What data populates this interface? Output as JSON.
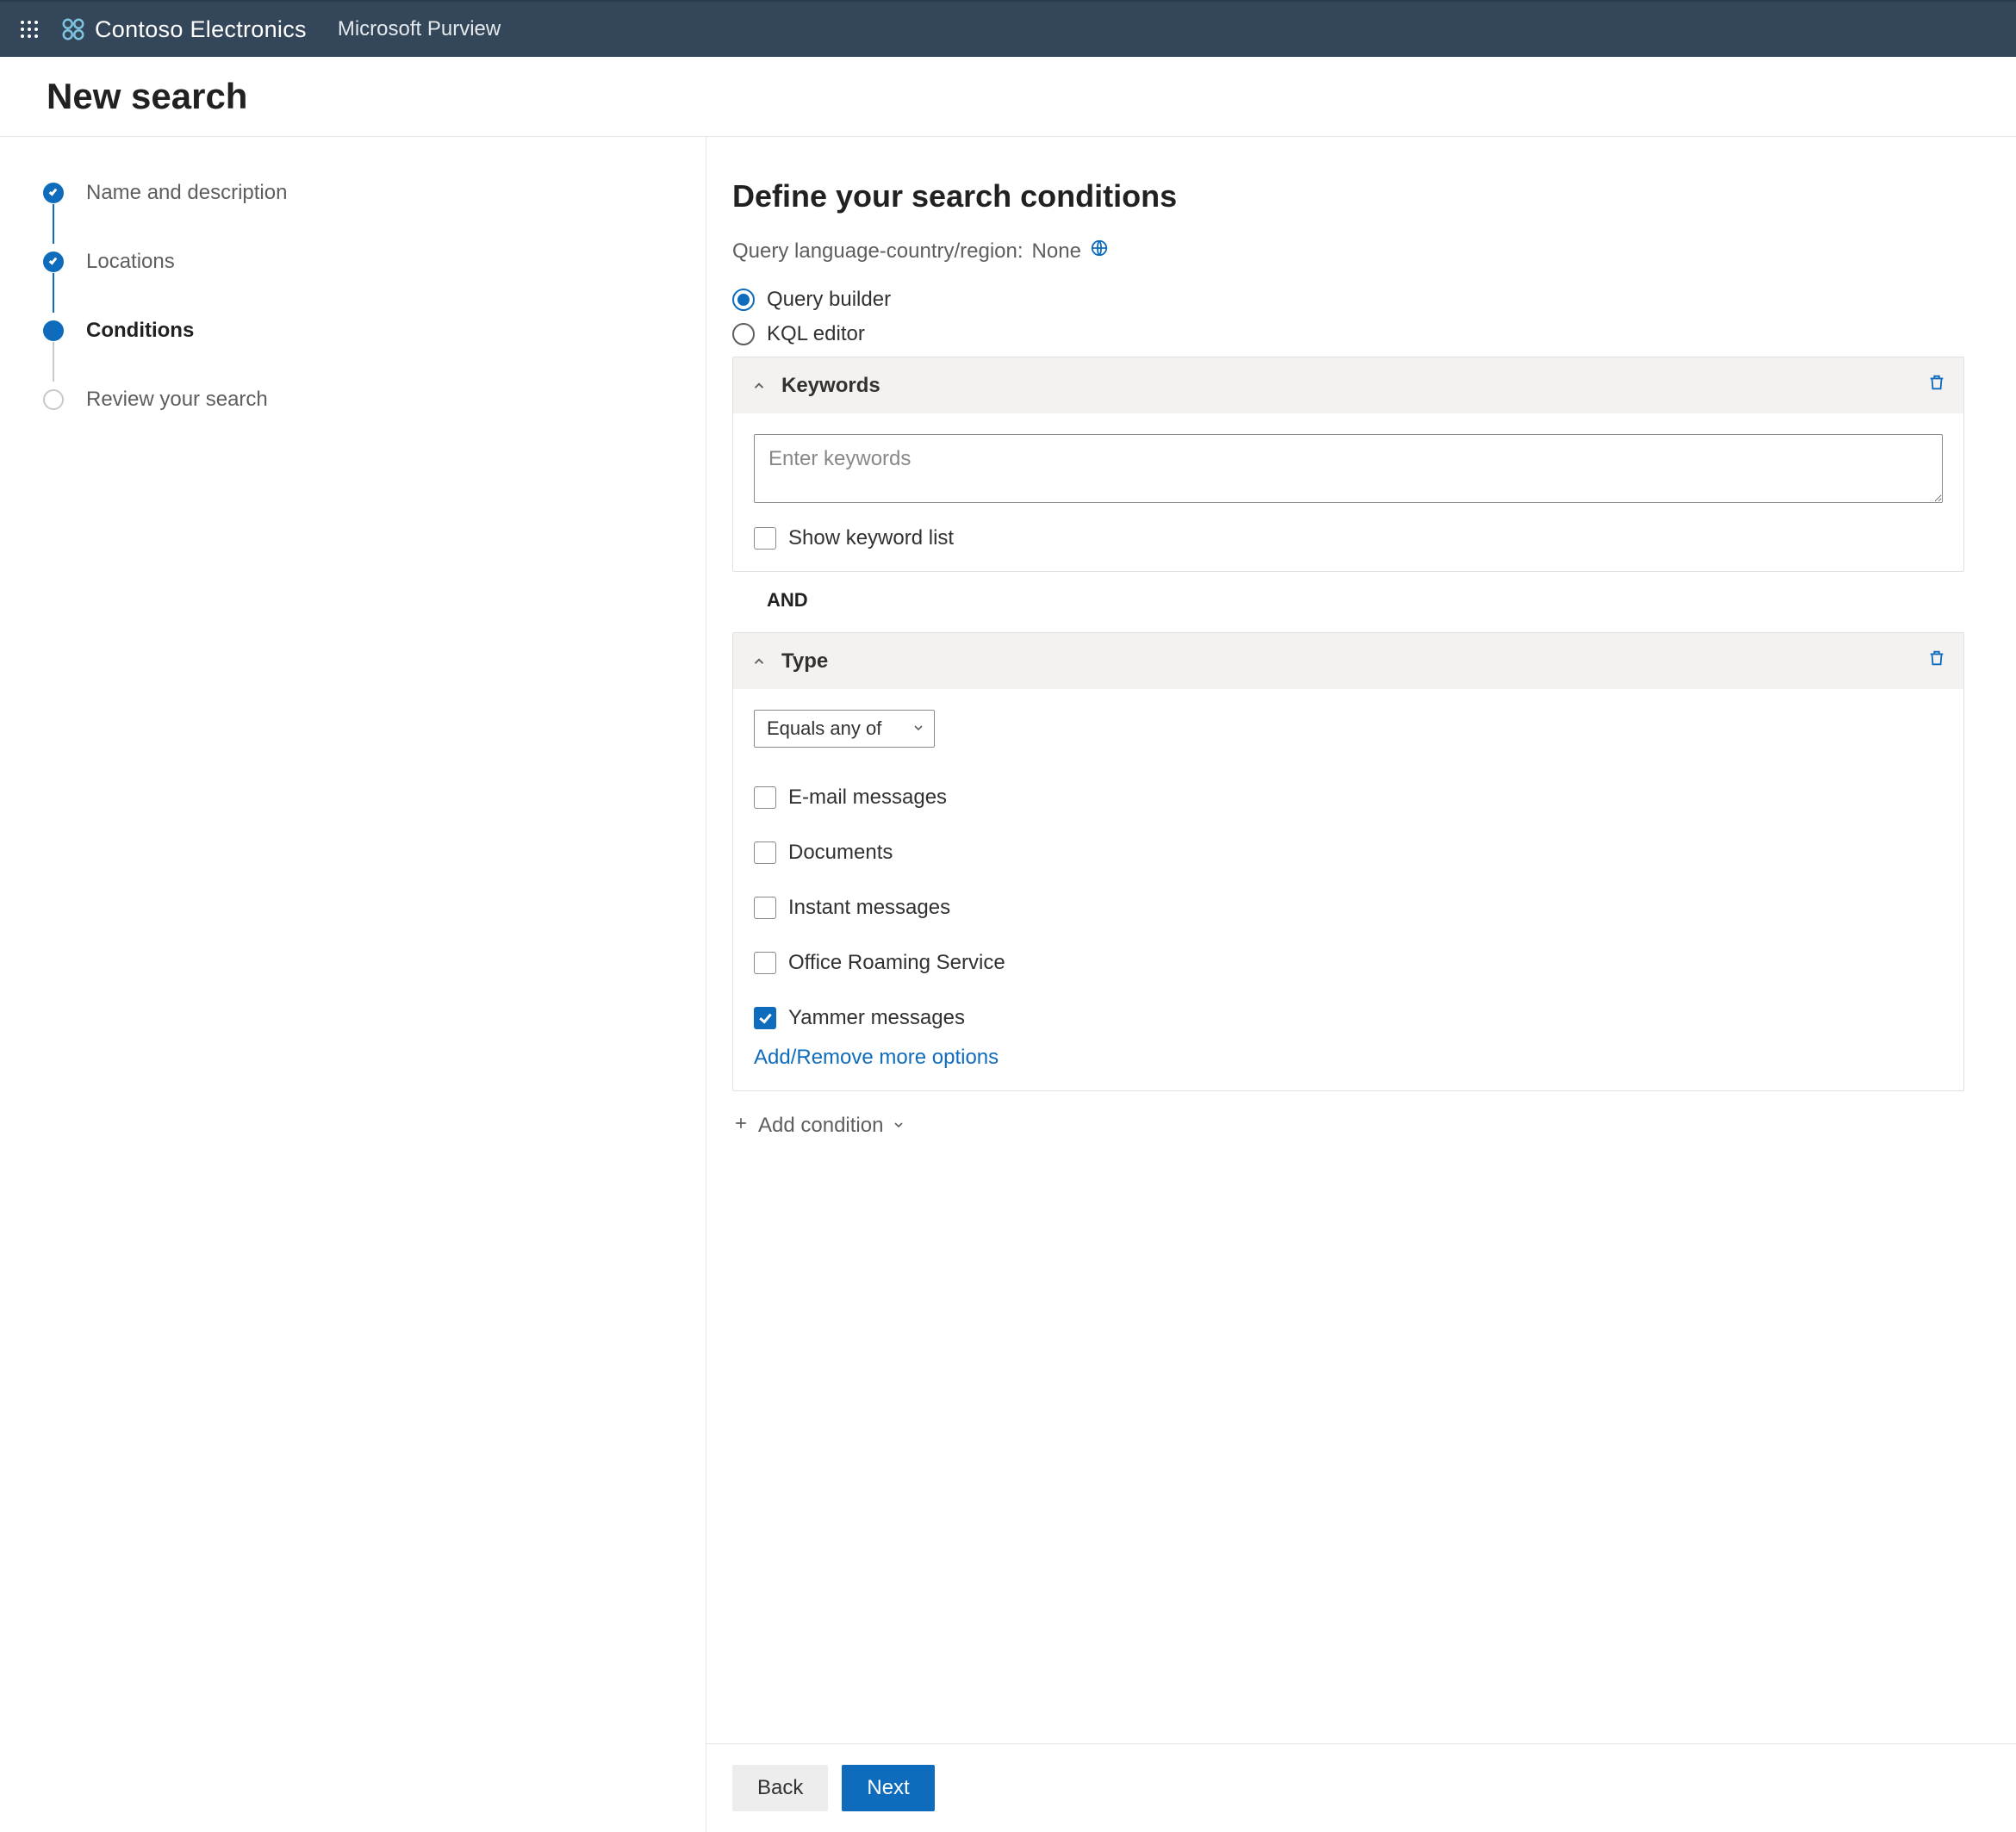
{
  "header": {
    "org": "Contoso Electronics",
    "product": "Microsoft Purview"
  },
  "page": {
    "title": "New search"
  },
  "steps": [
    {
      "label": "Name and description",
      "state": "done"
    },
    {
      "label": "Locations",
      "state": "done"
    },
    {
      "label": "Conditions",
      "state": "active"
    },
    {
      "label": "Review your search",
      "state": "pending"
    }
  ],
  "main": {
    "heading": "Define your search conditions",
    "queryLanguageLabel": "Query language-country/region:",
    "queryLanguageValue": "None",
    "modes": {
      "builder": "Query builder",
      "kql": "KQL editor",
      "selected": "builder"
    },
    "keywords": {
      "title": "Keywords",
      "placeholder": "Enter keywords",
      "value": "",
      "showListLabel": "Show keyword list",
      "showListChecked": false
    },
    "joiner": "AND",
    "type": {
      "title": "Type",
      "operator": "Equals any of",
      "options": [
        {
          "label": "E-mail messages",
          "checked": false
        },
        {
          "label": "Documents",
          "checked": false
        },
        {
          "label": "Instant messages",
          "checked": false
        },
        {
          "label": "Office Roaming Service",
          "checked": false
        },
        {
          "label": "Yammer messages",
          "checked": true
        }
      ],
      "moreOptions": "Add/Remove more options"
    },
    "addCondition": "Add condition"
  },
  "footer": {
    "back": "Back",
    "next": "Next"
  }
}
